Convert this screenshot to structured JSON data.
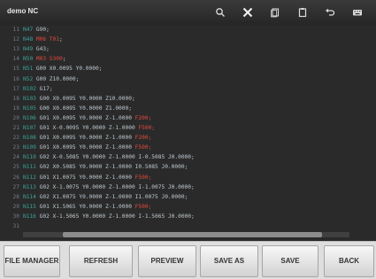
{
  "window": {
    "title": "demo NC"
  },
  "toolbar_icons": [
    "search-icon",
    "close-icon",
    "copy-icon",
    "paste-icon",
    "undo-icon",
    "keyboard-icon"
  ],
  "lines": [
    {
      "n": "11",
      "segs": [
        [
          "t-n",
          "N47 "
        ],
        [
          "t-g",
          "G90;"
        ]
      ]
    },
    {
      "n": "12",
      "segs": [
        [
          "t-n",
          "N48 "
        ],
        [
          "t-r",
          "M06 T01"
        ],
        [
          "t-g",
          ";"
        ]
      ]
    },
    {
      "n": "13",
      "segs": [
        [
          "t-n",
          "N49 "
        ],
        [
          "t-g",
          "G43;"
        ]
      ]
    },
    {
      "n": "14",
      "segs": [
        [
          "t-n",
          "N50 "
        ],
        [
          "t-r",
          "M03 S300"
        ],
        [
          "t-g",
          ";"
        ]
      ]
    },
    {
      "n": "15",
      "segs": [
        [
          "t-n",
          "N51 "
        ],
        [
          "t-g",
          "G00 X0.0095 Y0.0000;"
        ]
      ]
    },
    {
      "n": "16",
      "segs": [
        [
          "t-n",
          "N52 "
        ],
        [
          "t-g",
          "G00 Z10.0000;"
        ]
      ]
    },
    {
      "n": "17",
      "segs": [
        [
          "t-n",
          "N102 "
        ],
        [
          "t-g",
          "G17;"
        ]
      ]
    },
    {
      "n": "18",
      "segs": [
        [
          "t-n",
          "N103 "
        ],
        [
          "t-g",
          "G00 X0.0095 Y0.0000 Z10.0000;"
        ]
      ]
    },
    {
      "n": "19",
      "segs": [
        [
          "t-n",
          "N105 "
        ],
        [
          "t-g",
          "G00 X0.0095 Y0.0000 Z1.0000;"
        ]
      ]
    },
    {
      "n": "20",
      "segs": [
        [
          "t-n",
          "N106 "
        ],
        [
          "t-g",
          "G01 X0.0095 Y0.0000 Z-1.0000 "
        ],
        [
          "t-r",
          "F200;"
        ]
      ]
    },
    {
      "n": "21",
      "segs": [
        [
          "t-n",
          "N107 "
        ],
        [
          "t-g",
          "G01 X-0.0095 Y0.0000 Z-1.0000 "
        ],
        [
          "t-r",
          "F500;"
        ]
      ]
    },
    {
      "n": "22",
      "segs": [
        [
          "t-n",
          "N108 "
        ],
        [
          "t-g",
          "G01 X0.0095 Y0.0000 Z-1.0000 "
        ],
        [
          "t-r",
          "F200;"
        ]
      ]
    },
    {
      "n": "23",
      "segs": [
        [
          "t-n",
          "N109 "
        ],
        [
          "t-g",
          "G01 X0.0095 Y0.0000 Z-1.0000 "
        ],
        [
          "t-r",
          "F500;"
        ]
      ]
    },
    {
      "n": "24",
      "segs": [
        [
          "t-n",
          "N110 "
        ],
        [
          "t-g",
          "G02 X-0.5085 Y0.0000 Z-1.0000 I-0.5085 J0.0000;"
        ]
      ]
    },
    {
      "n": "25",
      "segs": [
        [
          "t-n",
          "N111 "
        ],
        [
          "t-g",
          "G02 X0.5085 Y0.0000 Z-1.0000 I0.5085 J0.0000;"
        ]
      ]
    },
    {
      "n": "26",
      "segs": [
        [
          "t-n",
          "N112 "
        ],
        [
          "t-g",
          "G01 X1.0075 Y0.0000 Z-1.0000 "
        ],
        [
          "t-r",
          "F500;"
        ]
      ]
    },
    {
      "n": "27",
      "segs": [
        [
          "t-n",
          "N113 "
        ],
        [
          "t-g",
          "G02 X-1.0075 Y0.0000 Z-1.0000 I-1.0075 J0.0000;"
        ]
      ]
    },
    {
      "n": "28",
      "segs": [
        [
          "t-n",
          "N114 "
        ],
        [
          "t-g",
          "G02 X1.0075 Y0.0000 Z-1.0000 I1.0075 J0.0000;"
        ]
      ]
    },
    {
      "n": "29",
      "segs": [
        [
          "t-n",
          "N115 "
        ],
        [
          "t-g",
          "G01 X1.5065 Y0.0000 Z-1.0000 "
        ],
        [
          "t-r",
          "F500;"
        ]
      ]
    },
    {
      "n": "30",
      "segs": [
        [
          "t-n",
          "N116 "
        ],
        [
          "t-g",
          "G02 X-1.5065 Y0.0000 Z-1.0000 I-1.5065 J0.0000;"
        ]
      ]
    },
    {
      "n": "31",
      "segs": [
        [
          "t-n",
          ""
        ],
        [
          "t-g",
          ""
        ]
      ]
    }
  ],
  "bottom": {
    "file_manager": "FILE MANAGER",
    "refresh": "REFRESH",
    "preview": "PREVIEW",
    "save_as": "SAVE AS",
    "save": "SAVE",
    "back": "BACK"
  },
  "colors": {
    "accent_red": "#e2493f",
    "line_number_teal": "#3aa39a",
    "text_gray": "#bfc9cf"
  }
}
